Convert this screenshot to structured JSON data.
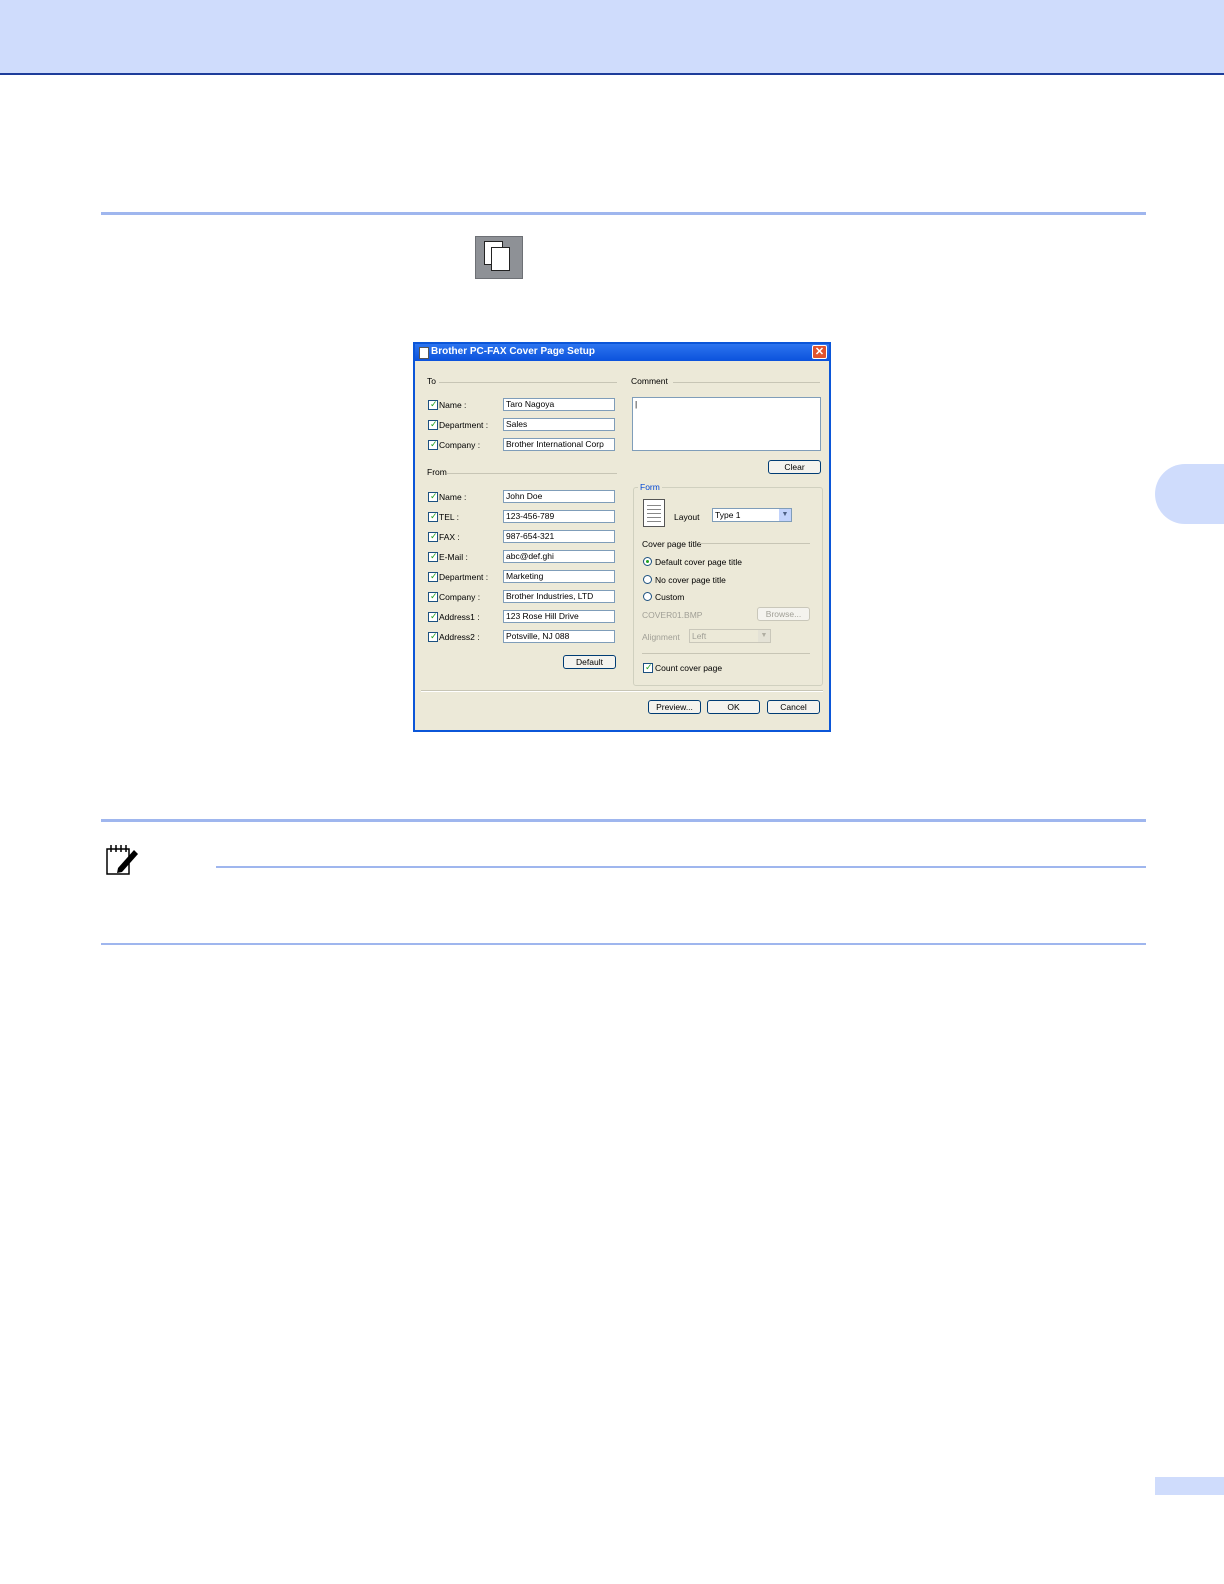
{
  "dialog": {
    "title": "Brother PC-FAX Cover Page Setup",
    "close_glyph": "✕",
    "to": {
      "group_label": "To",
      "fields": [
        {
          "label": "Name :",
          "value": "Taro Nagoya",
          "checked": true
        },
        {
          "label": "Department :",
          "value": "Sales",
          "checked": true
        },
        {
          "label": "Company :",
          "value": "Brother International Corp",
          "checked": true
        }
      ]
    },
    "from": {
      "group_label": "From",
      "fields": [
        {
          "label": "Name :",
          "value": "John Doe",
          "checked": true
        },
        {
          "label": "TEL :",
          "value": "123-456-789",
          "checked": true
        },
        {
          "label": "FAX :",
          "value": "987-654-321",
          "checked": true
        },
        {
          "label": "E-Mail :",
          "value": "abc@def.ghi",
          "checked": true
        },
        {
          "label": "Department :",
          "value": "Marketing",
          "checked": true
        },
        {
          "label": "Company :",
          "value": "Brother Industries, LTD",
          "checked": true
        },
        {
          "label": "Address1 :",
          "value": "123 Rose Hill Drive",
          "checked": true
        },
        {
          "label": "Address2 :",
          "value": "Potsville, NJ 088",
          "checked": true
        }
      ],
      "default_button": "Default"
    },
    "comment": {
      "group_label": "Comment",
      "value": "|",
      "clear_button": "Clear"
    },
    "form": {
      "group_label": "Form",
      "layout_label": "Layout",
      "layout_value": "Type 1",
      "cover_title_label": "Cover page title",
      "options": [
        {
          "label": "Default cover page title",
          "selected": true
        },
        {
          "label": "No cover page title",
          "selected": false
        },
        {
          "label": "Custom",
          "selected": false
        }
      ],
      "bmp_name": "COVER01.BMP",
      "browse_button": "Browse...",
      "alignment_label": "Alignment",
      "alignment_value": "Left",
      "count_label": "Count cover page",
      "count_checked": true
    },
    "buttons": {
      "preview": "Preview...",
      "ok": "OK",
      "cancel": "Cancel"
    },
    "checkmark": "✓"
  },
  "icons": {
    "cover_page_button": "cover-page-icon",
    "note": "note-pencil-icon"
  },
  "colors": {
    "header_band": "#cfdcfc",
    "rule": "#9fb6ee",
    "titlebar": "#0b52dc",
    "dialog_bg": "#ece9d8"
  }
}
